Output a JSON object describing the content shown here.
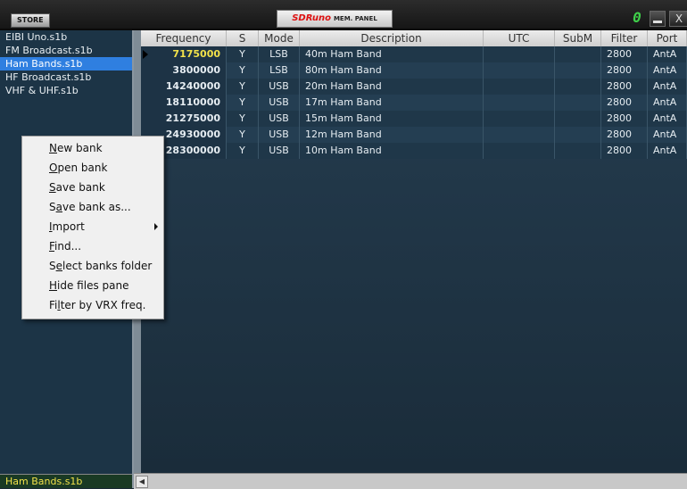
{
  "window": {
    "store_label": "STORE",
    "brand": "SDRuno",
    "title_rest": "MEM. PANEL",
    "vrx_digit": "0",
    "close_glyph": "X"
  },
  "files": {
    "items": [
      "EIBI Uno.s1b",
      "FM Broadcast.s1b",
      "Ham Bands.s1b",
      "HF Broadcast.s1b",
      "VHF & UHF.s1b"
    ],
    "selected": "Ham Bands.s1b",
    "footer": "Ham Bands.s1b"
  },
  "grid": {
    "columns": [
      "Frequency",
      "S",
      "Mode",
      "Description",
      "UTC",
      "SubM",
      "Filter",
      "Port"
    ],
    "rows": [
      {
        "frequency": "7175000",
        "s": "Y",
        "mode": "LSB",
        "description": "40m Ham Band",
        "utc": "",
        "subm": "",
        "filter": "2800",
        "port": "AntA"
      },
      {
        "frequency": "3800000",
        "s": "Y",
        "mode": "LSB",
        "description": "80m Ham Band",
        "utc": "",
        "subm": "",
        "filter": "2800",
        "port": "AntA"
      },
      {
        "frequency": "14240000",
        "s": "Y",
        "mode": "USB",
        "description": "20m Ham Band",
        "utc": "",
        "subm": "",
        "filter": "2800",
        "port": "AntA"
      },
      {
        "frequency": "18110000",
        "s": "Y",
        "mode": "USB",
        "description": "17m Ham Band",
        "utc": "",
        "subm": "",
        "filter": "2800",
        "port": "AntA"
      },
      {
        "frequency": "21275000",
        "s": "Y",
        "mode": "USB",
        "description": "15m Ham Band",
        "utc": "",
        "subm": "",
        "filter": "2800",
        "port": "AntA"
      },
      {
        "frequency": "24930000",
        "s": "Y",
        "mode": "USB",
        "description": "12m Ham Band",
        "utc": "",
        "subm": "",
        "filter": "2800",
        "port": "AntA"
      },
      {
        "frequency": "28300000",
        "s": "Y",
        "mode": "USB",
        "description": "10m Ham Band",
        "utc": "",
        "subm": "",
        "filter": "2800",
        "port": "AntA"
      }
    ]
  },
  "context_menu": {
    "items": [
      {
        "label": "New bank",
        "underline": "N",
        "has_submenu": false
      },
      {
        "label": "Open bank",
        "underline": "O",
        "has_submenu": false
      },
      {
        "label": "Save bank",
        "underline": "S",
        "has_submenu": false
      },
      {
        "label": "Save bank as...",
        "underline": "a",
        "has_submenu": false
      },
      {
        "label": "Import",
        "underline": "I",
        "has_submenu": true
      },
      {
        "label": "Find...",
        "underline": "F",
        "has_submenu": false
      },
      {
        "label": "Select banks folder",
        "underline": "e",
        "has_submenu": false
      },
      {
        "label": "Hide files pane",
        "underline": "H",
        "has_submenu": false
      },
      {
        "label": "Filter by VRX freq.",
        "underline": "l",
        "has_submenu": false
      }
    ]
  },
  "colors": {
    "active_frequency": "#f2e24a",
    "selected_file": "#2f7fe0",
    "footer_text": "#f2e24a"
  }
}
